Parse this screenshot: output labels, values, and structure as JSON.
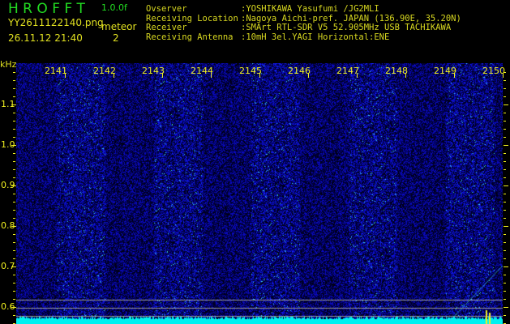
{
  "header": {
    "app_title": "H R O F F T",
    "version": "1.0.0f",
    "filename": "YY2611122140.png",
    "datetime": "26.11.12 21:40",
    "meteor_label": "meteor",
    "meteor_count": "2"
  },
  "info": [
    {
      "label": "Ovserver",
      "value": ":YOSHIKAWA Yasufumi /JG2MLI"
    },
    {
      "label": "Receiving Location",
      "value": ":Nagoya Aichi-pref. JAPAN (136.90E, 35.20N)"
    },
    {
      "label": "Receiver",
      "value": ":SMArt RTL-SDR V5 52.905MHz USB TACHIKAWA"
    },
    {
      "label": "Receiving Antenna",
      "value": ":10mH 3el.YAGI Horizontal:ENE"
    }
  ],
  "axis": {
    "unit": "kHz",
    "freq_labels": [
      "2141",
      "2142",
      "2143",
      "2144",
      "2145",
      "2146",
      "2147",
      "2148",
      "2149",
      "2150"
    ],
    "y_labels": [
      "1.1",
      "1.0",
      "0.9",
      "0.8",
      "0.7",
      "0.6"
    ]
  },
  "colors": {
    "text": "#d8d820",
    "title": "#22dd22",
    "baseline": "#00f0f0"
  }
}
